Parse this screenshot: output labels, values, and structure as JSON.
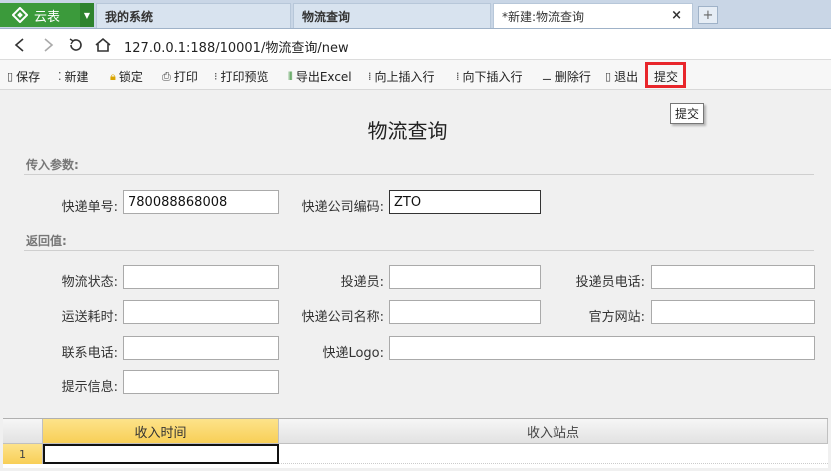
{
  "brand": {
    "label": "云表",
    "logo_icon": "diamond-logo-icon",
    "color": "#3b9a3b"
  },
  "tabs": [
    {
      "label": "我的系统"
    },
    {
      "label": "物流查询"
    },
    {
      "label": "*新建:物流查询",
      "close": "×"
    }
  ],
  "new_tab_icon": "plus-icon",
  "nav": {
    "url": "127.0.0.1:188/10001/物流查询/new"
  },
  "toolbar": {
    "save": "保存",
    "new": "新建",
    "lock": "锁定",
    "print": "打印",
    "print_preview": "打印预览",
    "export_excel": "导出Excel",
    "insert_above": "向上插入行",
    "insert_below": "向下插入行",
    "delete_row": "删除行",
    "exit": "退出",
    "submit": "提交"
  },
  "tooltip": "提交",
  "form": {
    "title": "物流查询",
    "input_section": "传入参数:",
    "output_section": "返回值:",
    "fields": {
      "tracking_no": {
        "label": "快递单号:",
        "value": "780088868008"
      },
      "company_code": {
        "label": "快递公司编码:",
        "value": "ZTO"
      },
      "logistics_status": {
        "label": "物流状态:",
        "value": ""
      },
      "courier": {
        "label": "投递员:",
        "value": ""
      },
      "courier_phone": {
        "label": "投递员电话:",
        "value": ""
      },
      "transit_time": {
        "label": "运送耗时:",
        "value": ""
      },
      "company_name": {
        "label": "快递公司名称:",
        "value": ""
      },
      "website": {
        "label": "官方网站:",
        "value": ""
      },
      "contact_phone": {
        "label": "联系电话:",
        "value": ""
      },
      "logo": {
        "label": "快递Logo:",
        "value": ""
      },
      "hint": {
        "label": "提示信息:",
        "value": ""
      }
    }
  },
  "grid": {
    "columns": [
      "收入时间",
      "收入站点"
    ],
    "rows": [
      {
        "num": "1",
        "time": "",
        "site": ""
      }
    ]
  }
}
